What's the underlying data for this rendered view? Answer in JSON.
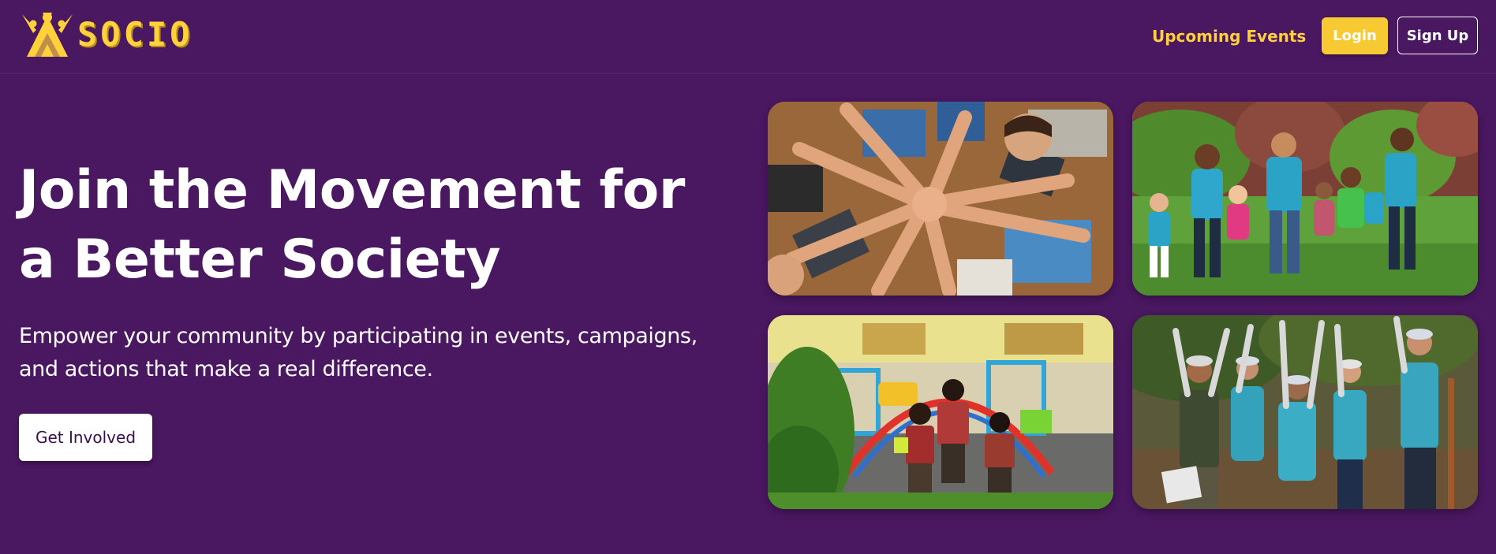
{
  "brand": {
    "name": "SOCIO",
    "logo_icon": "people-celebrating-logo-icon",
    "color": "#ffd13b"
  },
  "nav": {
    "upcoming_events": "Upcoming Events",
    "login": "Login",
    "signup": "Sign Up"
  },
  "hero": {
    "title": "Join the Movement for a Better Society",
    "subtitle": "Empower your community by participating in events, campaigns, and actions that make a real difference.",
    "cta": "Get Involved"
  },
  "colors": {
    "background": "#4a1761",
    "accent": "#f7c933",
    "text": "#ffffff"
  },
  "gallery": [
    {
      "id": "hands-together-photo"
    },
    {
      "id": "children-running-park-photo"
    },
    {
      "id": "children-playground-photo"
    },
    {
      "id": "volunteers-cheering-photo"
    }
  ]
}
